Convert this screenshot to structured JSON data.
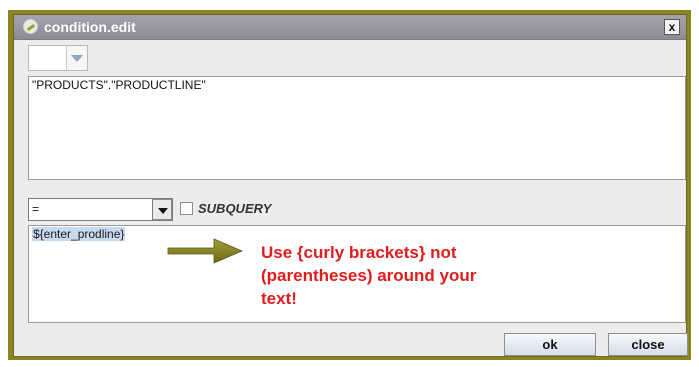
{
  "window": {
    "title": "condition.edit",
    "close_glyph": "x"
  },
  "column_combo": {
    "value": ""
  },
  "condition_expression": {
    "text": "\"PRODUCTS\".\"PRODUCTLINE\""
  },
  "operator_combo": {
    "value": "="
  },
  "subquery": {
    "label": "SUBQUERY",
    "checked": false
  },
  "parameter_value": {
    "text": "${enter_prodline}"
  },
  "annotation": {
    "lines": [
      "Use {curly brackets} not",
      "(parentheses) around your",
      "text!"
    ],
    "color": "#e01d1d",
    "arrow_color": "#7f7a1c"
  },
  "buttons": {
    "ok_label": "ok",
    "close_label": "close"
  }
}
